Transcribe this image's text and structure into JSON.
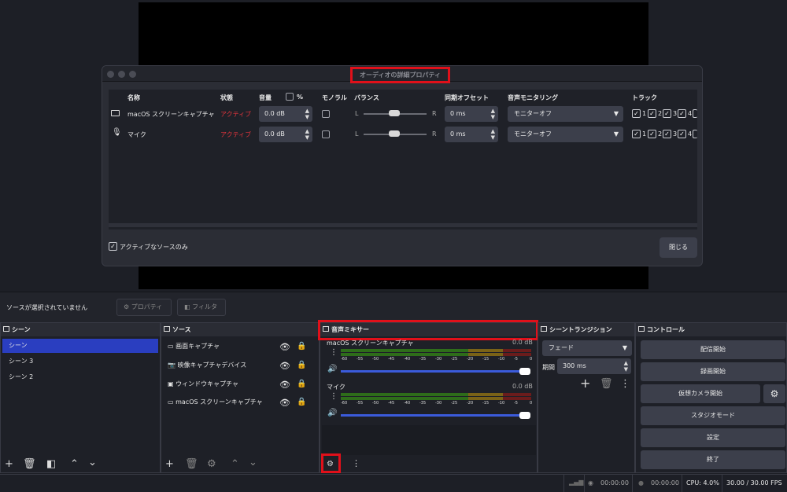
{
  "dialog": {
    "title": "オーディオの詳細プロパティ",
    "headers": {
      "name": "名称",
      "status": "状態",
      "volume": "音量",
      "percent": "%",
      "mono": "モノラル",
      "balance": "バランス",
      "sync_offset": "同期オフセット",
      "monitoring": "音声モニタリング",
      "tracks": "トラック"
    },
    "rows": [
      {
        "name": "macOS スクリーンキャプチャ",
        "status": "アクティブ",
        "volume": "0.0 dB",
        "balance_l": "L",
        "balance_r": "R",
        "offset": "0 ms",
        "monitoring": "モニターオフ",
        "tracks": [
          "1",
          "2",
          "3",
          "4"
        ]
      },
      {
        "name": "マイク",
        "status": "アクティブ",
        "volume": "0.0 dB",
        "balance_l": "L",
        "balance_r": "R",
        "offset": "0 ms",
        "monitoring": "モニターオフ",
        "tracks": [
          "1",
          "2",
          "3",
          "4"
        ]
      }
    ],
    "active_only_label": "アクティブなソースのみ",
    "close_label": "閉じる"
  },
  "toolbar": {
    "no_source": "ソースが選択されていません",
    "properties": "プロパティ",
    "filters": "フィルタ"
  },
  "scenes": {
    "title": "シーン",
    "items": [
      "シーン",
      "シーン 3",
      "シーン 2"
    ]
  },
  "sources": {
    "title": "ソース",
    "items": [
      "画面キャプチャ",
      "映像キャプチャデバイス",
      "ウィンドウキャプチャ",
      "macOS スクリーンキャプチャ"
    ]
  },
  "mixer": {
    "title": "音声ミキサー",
    "scale": [
      "-60",
      "-55",
      "-50",
      "-45",
      "-40",
      "-35",
      "-30",
      "-25",
      "-20",
      "-15",
      "-10",
      "-5",
      "0"
    ],
    "channels": [
      {
        "name": "macOS スクリーンキャプチャ",
        "db": "0.0 dB",
        "level": 0.98
      },
      {
        "name": "マイク",
        "db": "0.0 dB",
        "level": 0.98
      }
    ]
  },
  "transitions": {
    "title": "シーントランジション",
    "type": "フェード",
    "duration_label": "期間",
    "duration": "300 ms"
  },
  "controls": {
    "title": "コントロール",
    "stream": "配信開始",
    "record": "録画開始",
    "virtual_cam": "仮想カメラ開始",
    "studio": "スタジオモード",
    "settings": "設定",
    "exit": "終了"
  },
  "status": {
    "stream_time": "00:00:00",
    "rec_time": "00:00:00",
    "cpu": "CPU: 4.0%",
    "fps": "30.00 / 30.00 FPS"
  }
}
